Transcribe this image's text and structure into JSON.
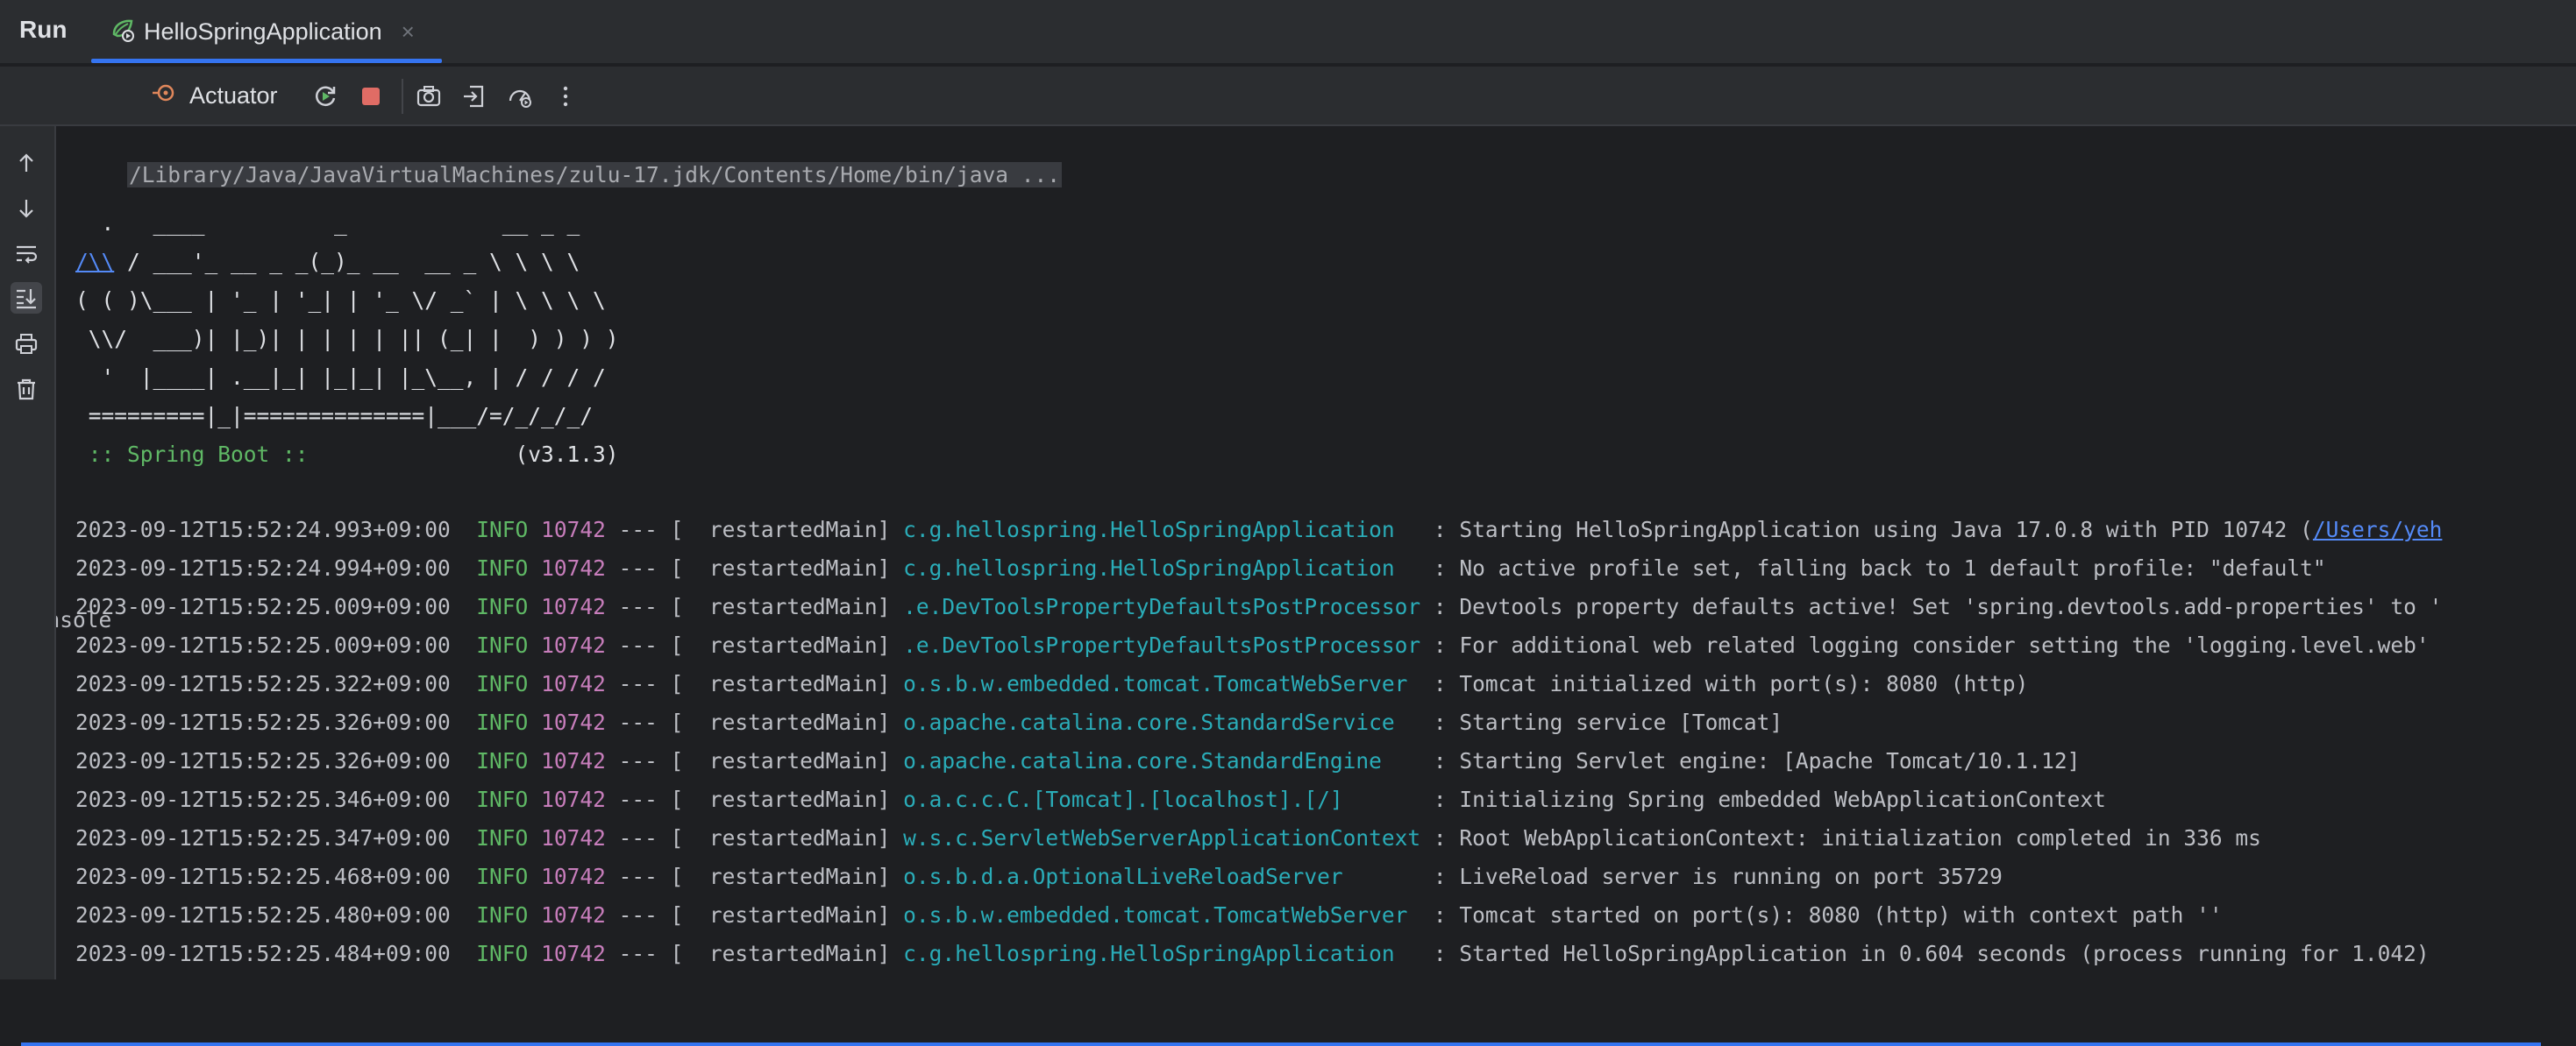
{
  "window": {
    "panel_title": "Run",
    "tab_label": "HelloSpringApplication",
    "tab_close": "×"
  },
  "toolbar": {
    "console_tab": "Console",
    "actuator_tab": "Actuator",
    "icons": [
      "rerun-icon",
      "stop-icon",
      "screenshot-icon",
      "exit-icon",
      "profiler-icon",
      "more-icon"
    ]
  },
  "gutter": {
    "icons": [
      "arrow-up-icon",
      "arrow-down-icon",
      "soft-wrap-icon",
      "scroll-to-end-icon",
      "print-icon",
      "trash-icon"
    ]
  },
  "console": {
    "command": "/Library/Java/JavaVirtualMachines/zulu-17.jdk/Contents/Home/bin/java ...",
    "banner": [
      "  .   ____          _            __ _ _",
      "",
      "( ( )\\___ | '_ | '_| | '_ \\/ _` | \\ \\ \\ \\",
      " \\\\/  ___)| |_)| | | | | || (_| |  ) ) ) )",
      "  '  |____| .__|_| |_|_| |_\\__, | / / / /",
      " =========|_|==============|___/=/_/_/_/"
    ],
    "banner_line2_link": "/\\\\",
    "banner_line2_rest": " / ___'_ __ _ _(_)_ __  __ _ \\ \\ \\ \\",
    "spring_boot_label": " :: Spring Boot :: ",
    "spring_boot_version": "               (v3.1.3)",
    "logs": [
      {
        "ts": "2023-09-12T15:52:24.993+09:00",
        "level": "INFO",
        "pid": "10742",
        "thread": " --- [  restartedMain] ",
        "logger": "c.g.hellospring.HelloSpringApplication  ",
        "msg": " : Starting HelloSpringApplication using Java 17.0.8 with PID 10742 (",
        "link": "/Users/yeh"
      },
      {
        "ts": "2023-09-12T15:52:24.994+09:00",
        "level": "INFO",
        "pid": "10742",
        "thread": " --- [  restartedMain] ",
        "logger": "c.g.hellospring.HelloSpringApplication  ",
        "msg": " : No active profile set, falling back to 1 default profile: \"default\""
      },
      {
        "ts": "2023-09-12T15:52:25.009+09:00",
        "level": "INFO",
        "pid": "10742",
        "thread": " --- [  restartedMain] ",
        "logger": ".e.DevToolsPropertyDefaultsPostProcessor",
        "msg": " : Devtools property defaults active! Set 'spring.devtools.add-properties' to '"
      },
      {
        "ts": "2023-09-12T15:52:25.009+09:00",
        "level": "INFO",
        "pid": "10742",
        "thread": " --- [  restartedMain] ",
        "logger": ".e.DevToolsPropertyDefaultsPostProcessor",
        "msg": " : For additional web related logging consider setting the 'logging.level.web'"
      },
      {
        "ts": "2023-09-12T15:52:25.322+09:00",
        "level": "INFO",
        "pid": "10742",
        "thread": " --- [  restartedMain] ",
        "logger": "o.s.b.w.embedded.tomcat.TomcatWebServer ",
        "msg": " : Tomcat initialized with port(s): 8080 (http)"
      },
      {
        "ts": "2023-09-12T15:52:25.326+09:00",
        "level": "INFO",
        "pid": "10742",
        "thread": " --- [  restartedMain] ",
        "logger": "o.apache.catalina.core.StandardService  ",
        "msg": " : Starting service [Tomcat]"
      },
      {
        "ts": "2023-09-12T15:52:25.326+09:00",
        "level": "INFO",
        "pid": "10742",
        "thread": " --- [  restartedMain] ",
        "logger": "o.apache.catalina.core.StandardEngine   ",
        "msg": " : Starting Servlet engine: [Apache Tomcat/10.1.12]"
      },
      {
        "ts": "2023-09-12T15:52:25.346+09:00",
        "level": "INFO",
        "pid": "10742",
        "thread": " --- [  restartedMain] ",
        "logger": "o.a.c.c.C.[Tomcat].[localhost].[/]      ",
        "msg": " : Initializing Spring embedded WebApplicationContext"
      },
      {
        "ts": "2023-09-12T15:52:25.347+09:00",
        "level": "INFO",
        "pid": "10742",
        "thread": " --- [  restartedMain] ",
        "logger": "w.s.c.ServletWebServerApplicationContext",
        "msg": " : Root WebApplicationContext: initialization completed in 336 ms"
      },
      {
        "ts": "2023-09-12T15:52:25.468+09:00",
        "level": "INFO",
        "pid": "10742",
        "thread": " --- [  restartedMain] ",
        "logger": "o.s.b.d.a.OptionalLiveReloadServer      ",
        "msg": " : LiveReload server is running on port 35729"
      },
      {
        "ts": "2023-09-12T15:52:25.480+09:00",
        "level": "INFO",
        "pid": "10742",
        "thread": " --- [  restartedMain] ",
        "logger": "o.s.b.w.embedded.tomcat.TomcatWebServer ",
        "msg": " : Tomcat started on port(s): 8080 (http) with context path ''"
      },
      {
        "ts": "2023-09-12T15:52:25.484+09:00",
        "level": "INFO",
        "pid": "10742",
        "thread": " --- [  restartedMain] ",
        "logger": "c.g.hellospring.HelloSpringApplication  ",
        "msg": " : Started HelloSpringApplication in 0.604 seconds (process running for 1.042)"
      }
    ]
  }
}
